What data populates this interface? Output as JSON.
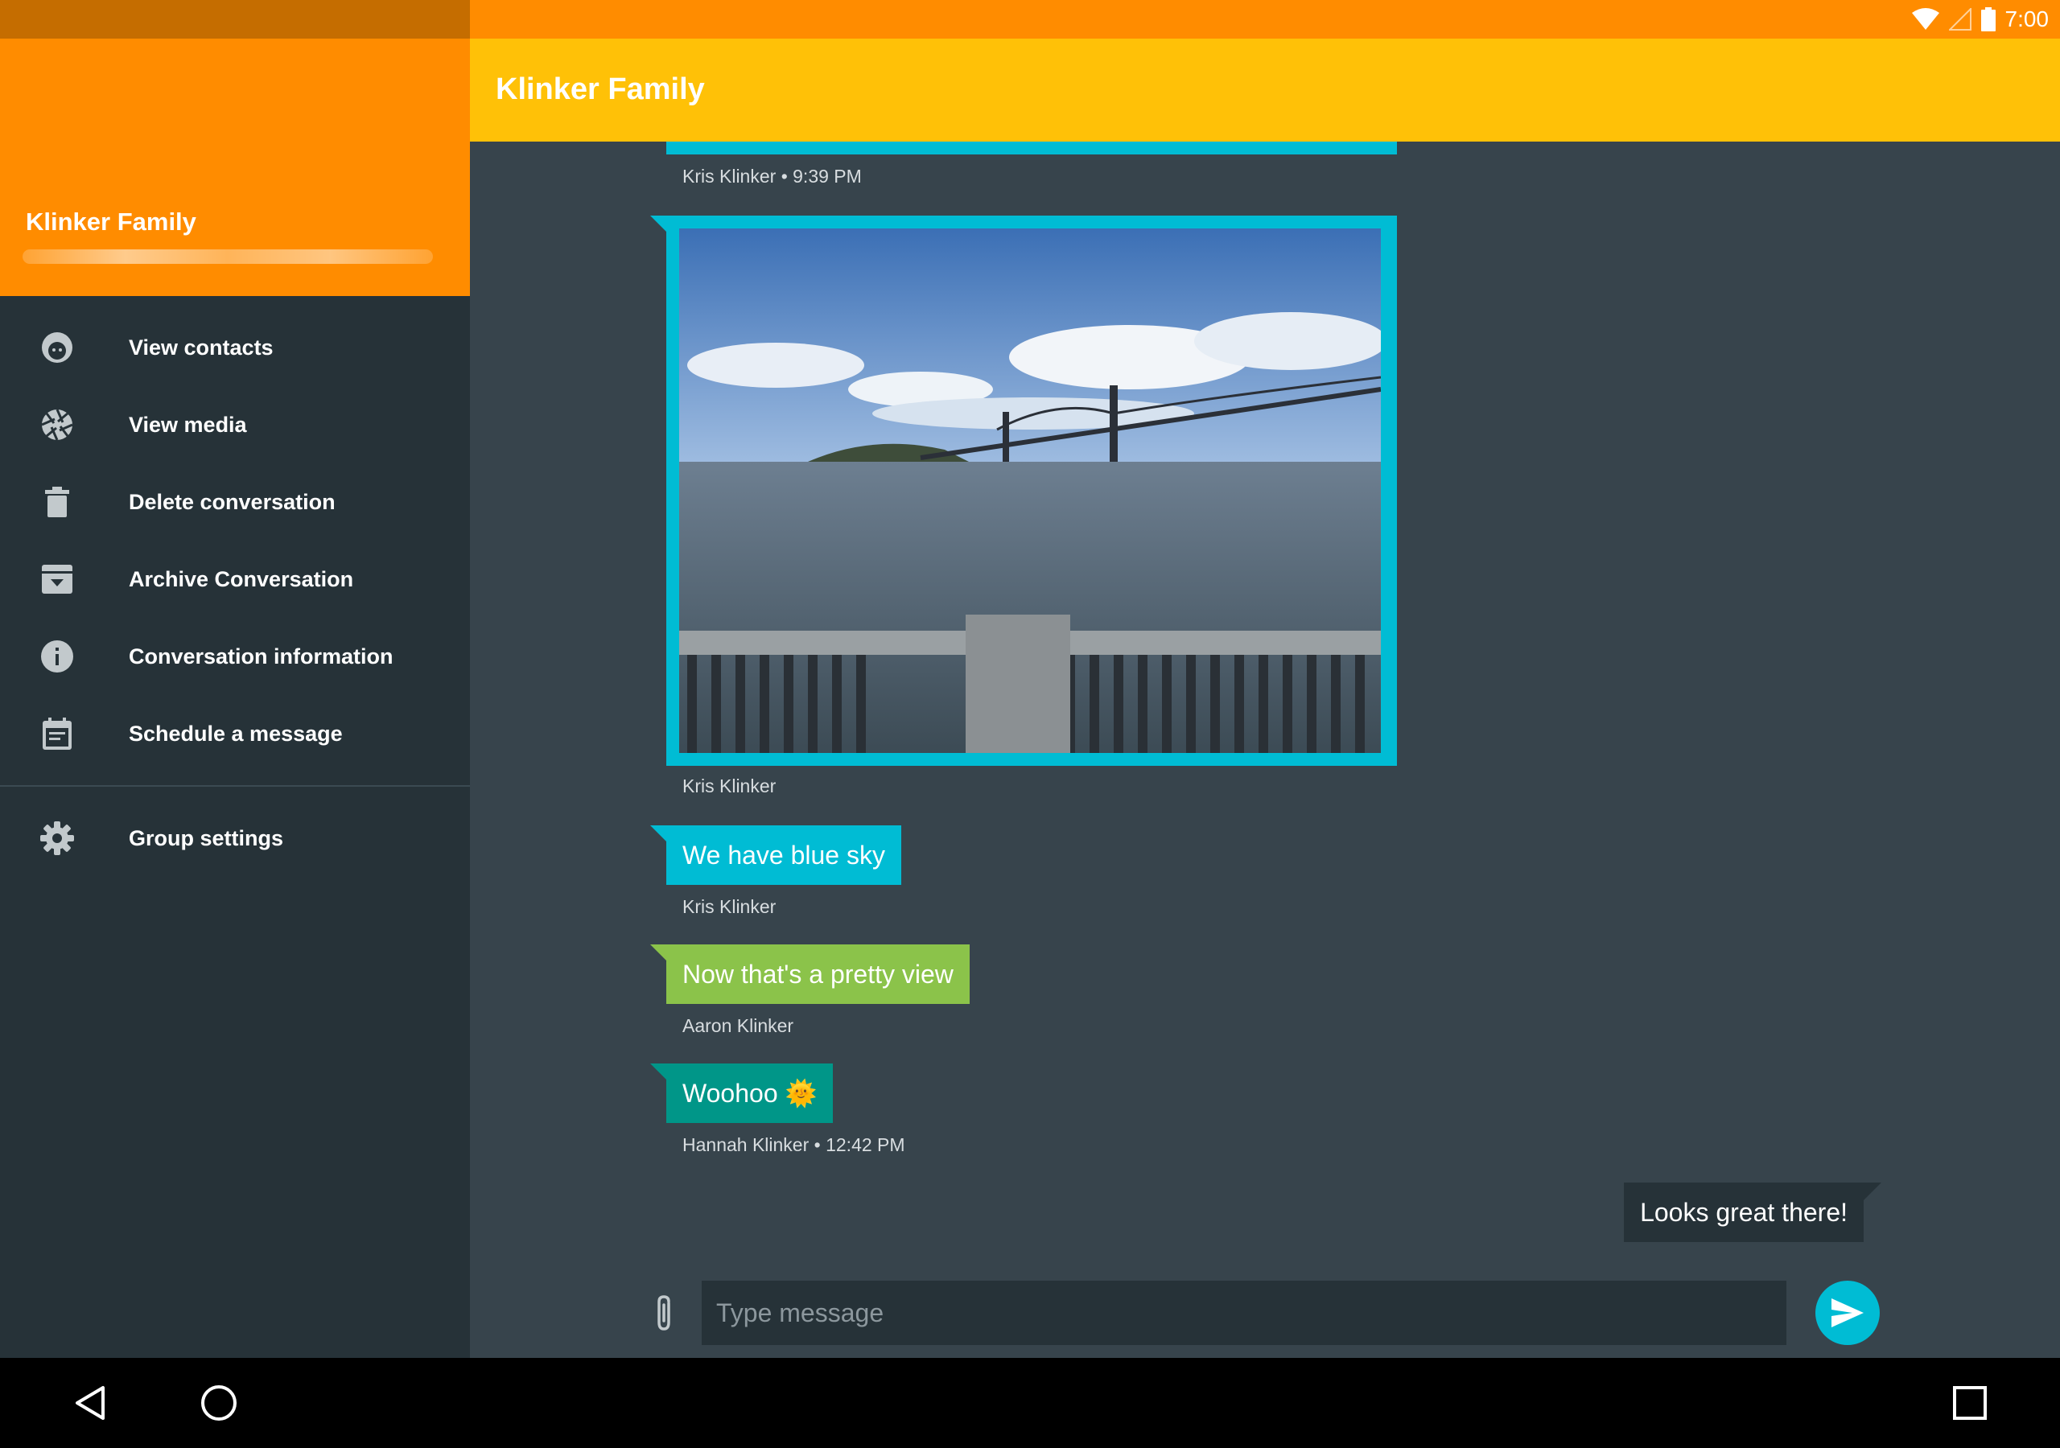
{
  "status_bar": {
    "time": "7:00"
  },
  "drawer": {
    "title": "Klinker Family",
    "items": [
      {
        "label": "View contacts",
        "icon": "contact-face-icon"
      },
      {
        "label": "View media",
        "icon": "camera-shutter-icon"
      },
      {
        "label": "Delete conversation",
        "icon": "trash-icon"
      },
      {
        "label": "Archive Conversation",
        "icon": "archive-icon"
      },
      {
        "label": "Conversation information",
        "icon": "info-icon"
      },
      {
        "label": "Schedule a message",
        "icon": "calendar-icon"
      }
    ],
    "settings": {
      "label": "Group settings",
      "icon": "gear-icon"
    }
  },
  "toolbar": {
    "title": "Klinker Family"
  },
  "messages": [
    {
      "meta": "Kris Klinker • 9:39 PM"
    },
    {
      "type": "image",
      "meta": "Kris Klinker"
    },
    {
      "text": "We have blue sky",
      "meta": "Kris Klinker",
      "color": "#00bcd4"
    },
    {
      "text": "Now that's a pretty view",
      "meta": "Aaron Klinker",
      "color": "#8bc34a"
    },
    {
      "text": "Woohoo 🌞",
      "meta": "Hannah Klinker • 12:42 PM",
      "color": "#009688"
    },
    {
      "text": "Looks great there!",
      "outgoing": true,
      "color": "#263238"
    }
  ],
  "composer": {
    "placeholder": "Type message"
  },
  "colors": {
    "status_left": "#c56d00",
    "status_right": "#ff8c00",
    "toolbar": "#ffc107",
    "drawer_bg": "#263238",
    "chat_bg": "#37444c",
    "accent": "#00bcd4"
  }
}
